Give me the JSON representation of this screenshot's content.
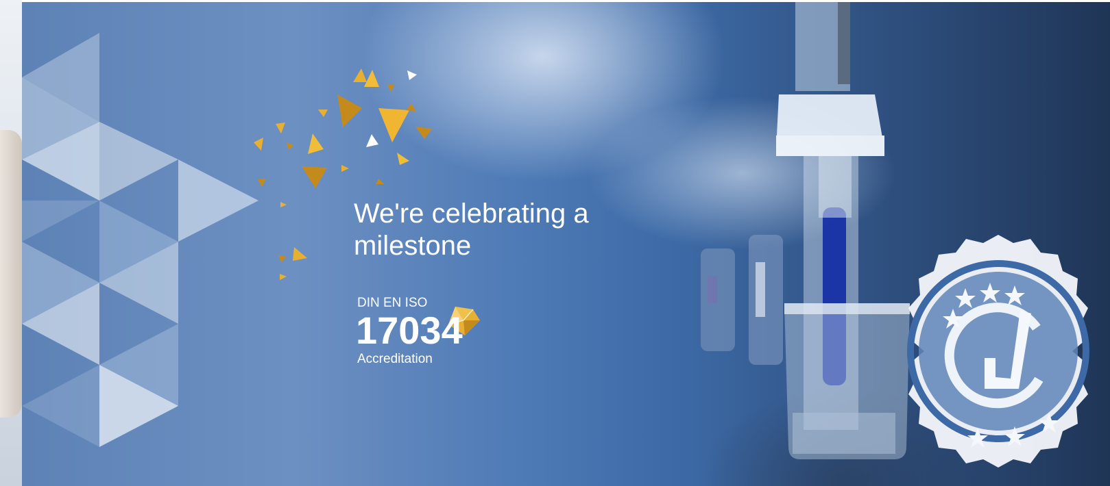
{
  "hero": {
    "headline": "We're celebrating a milestone",
    "standard_prefix": "DIN EN ISO",
    "standard_number": "17034",
    "standard_suffix": "Accreditation"
  },
  "icons": [
    "triangle-pattern",
    "confetti",
    "gem-icon",
    "certificate-seal-icon",
    "checkmark-icon",
    "star-icon",
    "lab-electrode-photo"
  ],
  "colors": {
    "gold": "#e8b033",
    "gold_dark": "#c48b1c",
    "blue": "#3d6aa6",
    "white": "#ffffff"
  }
}
